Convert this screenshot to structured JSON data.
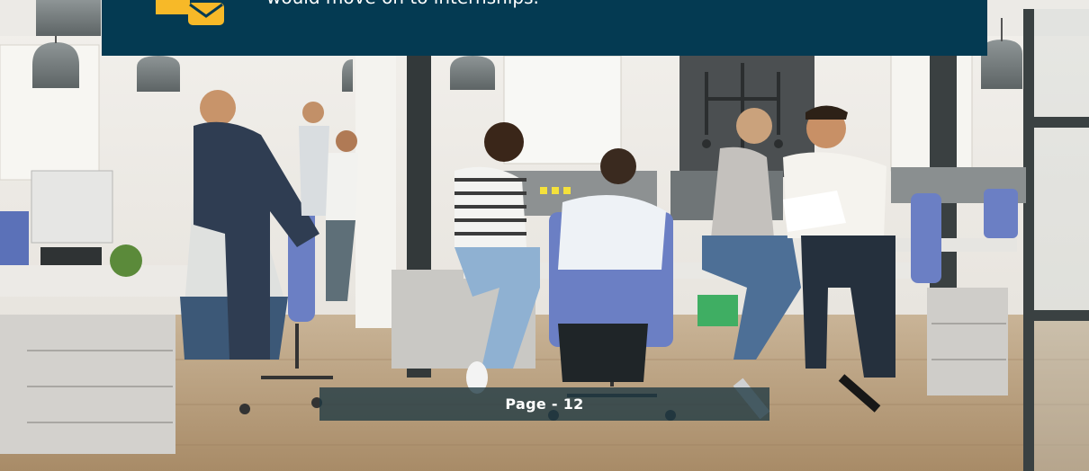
{
  "banner": {
    "text": "would move on to internships.",
    "icon": "folder-envelope-icon",
    "background": "#043a52",
    "icon_color": "#f7b928"
  },
  "page": {
    "label": "Page  -  12"
  },
  "photo": {
    "subject": "office-team-photo"
  }
}
